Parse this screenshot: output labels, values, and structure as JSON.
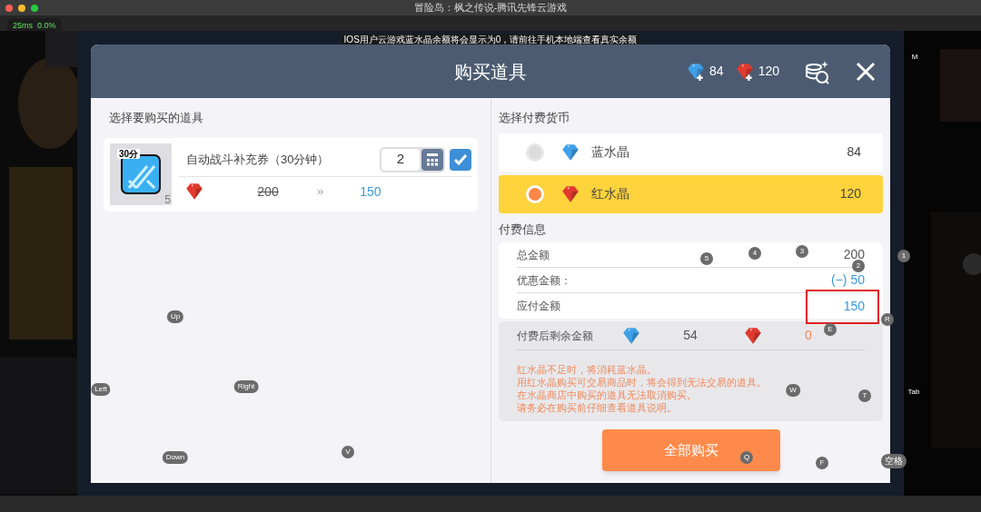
{
  "window": {
    "title": "冒险岛：枫之传说-腾讯先锋云游戏"
  },
  "stats": "25ms  0.0%",
  "toast": "IOS用户云游戏蓝水晶余额将会显示为0，请前往手机本地端查看真实余额",
  "dialog": {
    "title": "购买道具",
    "balances": [
      {
        "amount": "84",
        "color": "#3fa0e8"
      },
      {
        "amount": "120",
        "color": "#e23a2e"
      }
    ],
    "items_heading": "选择要购买的道具",
    "items": [
      {
        "icon_label": "30分",
        "stack_count": "5",
        "name": "自动战斗补充券（30分钟）",
        "quantity": "2",
        "checked": true,
        "old_price": "200",
        "arrow": "»",
        "price": "150"
      }
    ],
    "currency_heading": "选择付费货币",
    "currencies": [
      {
        "name": "蓝水晶",
        "amount": "84",
        "color": "#3fa0e8",
        "selected": false
      },
      {
        "name": "红水晶",
        "amount": "120",
        "color": "#e23a2e",
        "selected": true
      }
    ],
    "payment_heading": "付费信息",
    "payment_rows": [
      {
        "label": "总金额",
        "value": "200",
        "kind": "plain",
        "highlighted": false
      },
      {
        "label": "优惠金额：",
        "value": "(−) 50",
        "kind": "accent",
        "highlighted": false
      },
      {
        "label": "应付金额",
        "value": "150",
        "kind": "accent",
        "highlighted": true
      }
    ],
    "remaining": {
      "label": "付费后剩余金额",
      "balances": [
        {
          "amount": "54",
          "color": "#3fa0e8"
        },
        {
          "amount": "0",
          "color": "#e23a2e"
        }
      ]
    },
    "notice": [
      "红水晶不足时，将消耗蓝水晶。",
      "用红水晶购买可交易商品时，将会得到无法交易的道具。",
      "在水晶商店中购买的道具无法取消购买。",
      "请务必在购买前仔细查看道具说明。"
    ],
    "buy_button": "全部购买"
  },
  "key_hints": [
    {
      "label": "M"
    },
    {
      "label": "5"
    },
    {
      "label": "4"
    },
    {
      "label": "3"
    },
    {
      "label": "2"
    },
    {
      "label": "1"
    },
    {
      "label": "R"
    },
    {
      "label": "E"
    },
    {
      "label": "Up"
    },
    {
      "label": "Left"
    },
    {
      "label": "Right"
    },
    {
      "label": "W"
    },
    {
      "label": "T"
    },
    {
      "label": "Tab"
    },
    {
      "label": "Down"
    },
    {
      "label": "V"
    },
    {
      "label": "Q"
    },
    {
      "label": "F"
    },
    {
      "label": "空格"
    }
  ]
}
